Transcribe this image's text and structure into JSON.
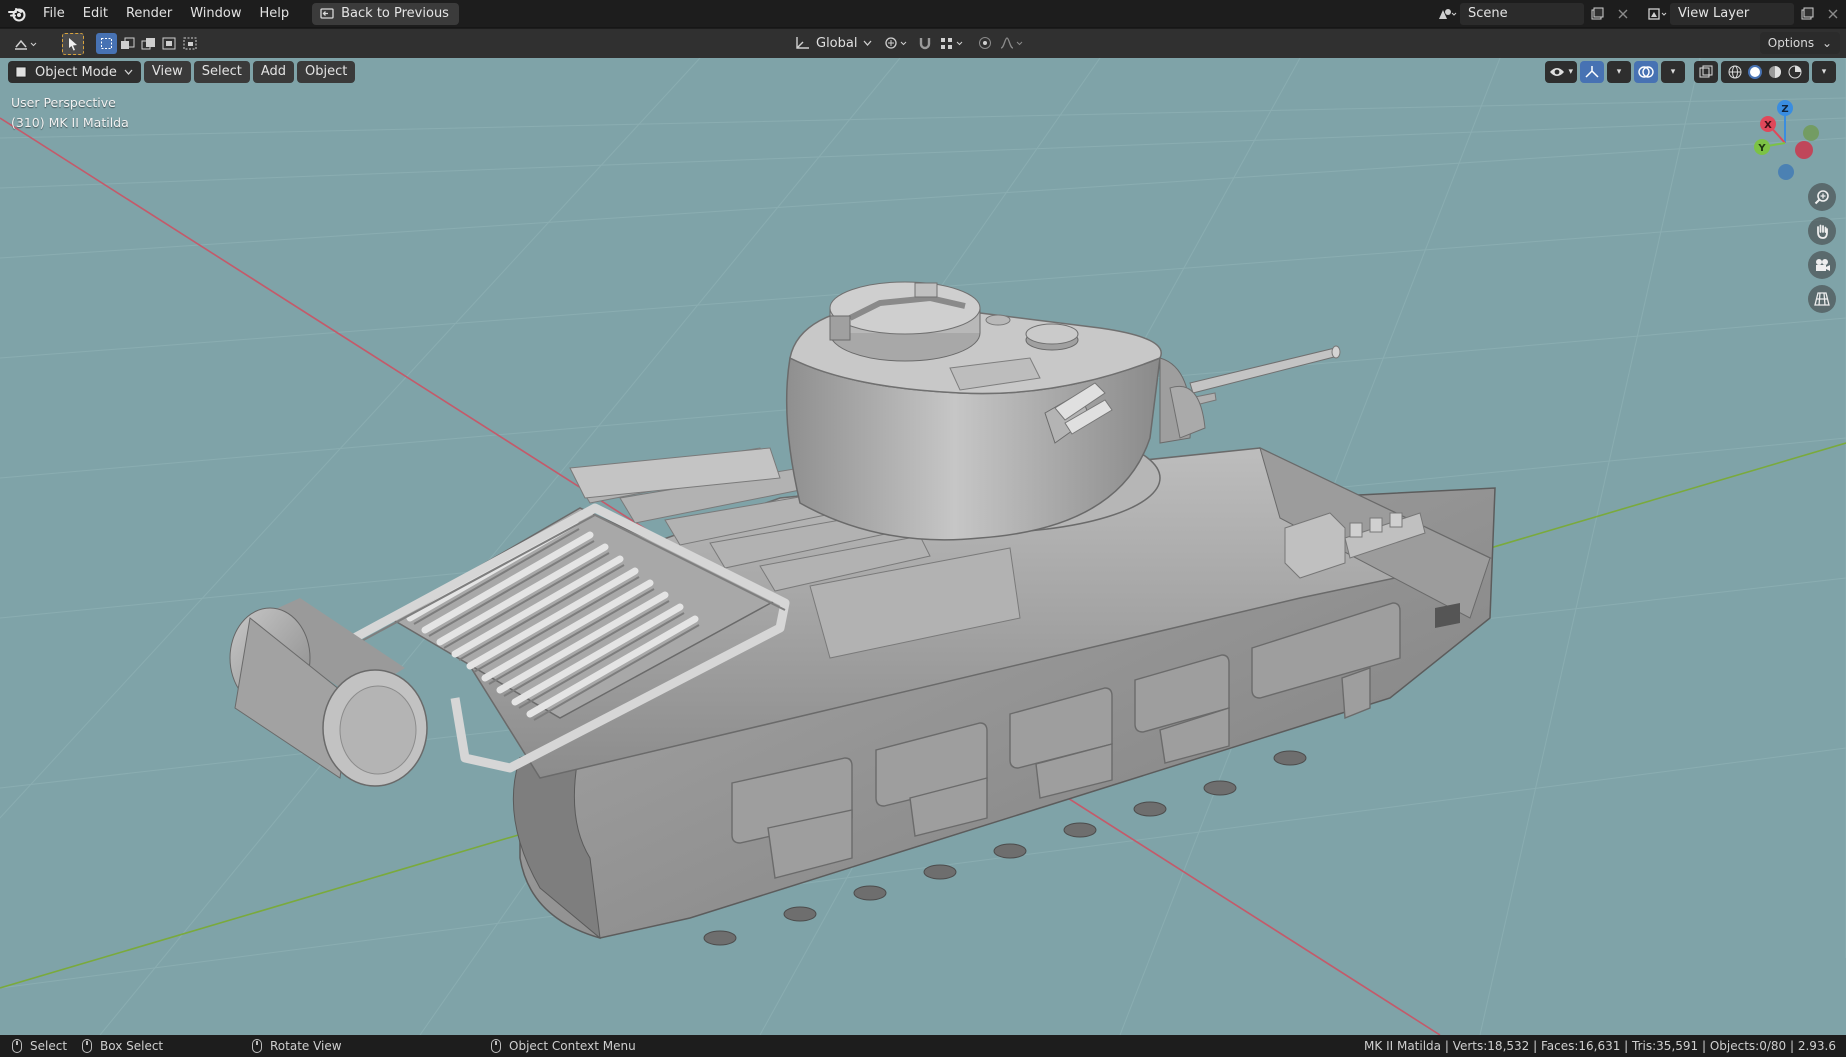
{
  "menu": {
    "items": [
      "File",
      "Edit",
      "Render",
      "Window",
      "Help"
    ],
    "back_button": "Back to Previous"
  },
  "top_right": {
    "scene_name": "Scene",
    "view_layer_name": "View Layer"
  },
  "tool_header": {
    "transform_orientation": "Global",
    "options_label": "Options"
  },
  "viewport_header": {
    "mode": "Object Mode",
    "buttons": [
      "View",
      "Select",
      "Add",
      "Object"
    ]
  },
  "overlay": {
    "perspective": "User Perspective",
    "object_info": "(310) MK II Matilda"
  },
  "gizmo": {
    "axes": [
      "Z",
      "X",
      "Y"
    ],
    "colors": {
      "x": "#e0485a",
      "y": "#7cc245",
      "z": "#3a8de0"
    }
  },
  "status": {
    "hints": [
      {
        "icon": "mouse-left-icon",
        "label": "Select"
      },
      {
        "icon": "mouse-drag-icon",
        "label": "Box Select"
      },
      {
        "icon": "mouse-middle-icon",
        "label": "Rotate View"
      },
      {
        "icon": "mouse-right-icon",
        "label": "Object Context Menu"
      }
    ],
    "stats": "MK II Matilda | Verts:18,532 | Faces:16,631 | Tris:35,591 | Objects:0/80 | 2.93.6"
  },
  "colors": {
    "viewport_bg": "#7fa3a8",
    "accent": "#4772b3",
    "x_axis_line": "#c45a6a",
    "y_axis_line": "#7aaa3c"
  }
}
